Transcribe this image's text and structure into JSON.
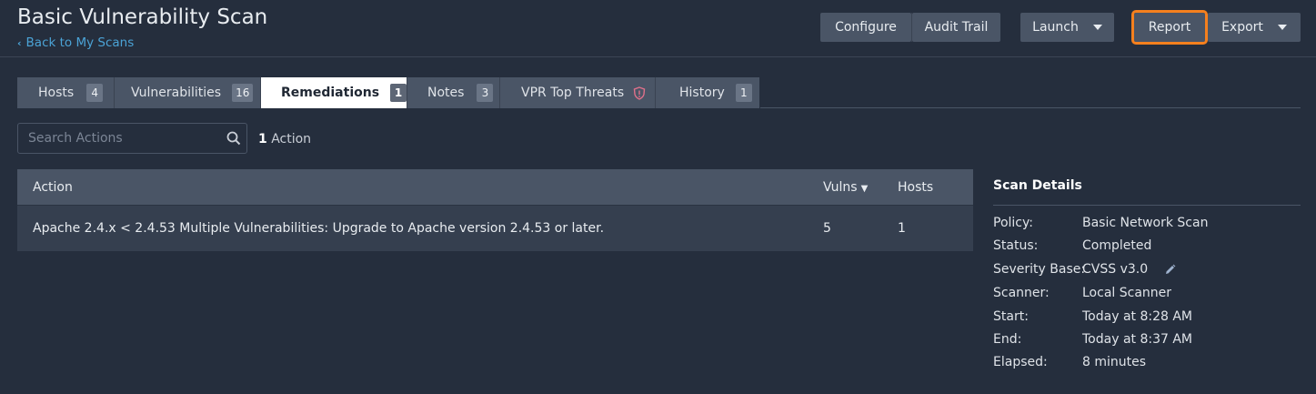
{
  "header": {
    "title": "Basic Vulnerability Scan",
    "back_link": "Back to My Scans"
  },
  "toolbar": {
    "configure": "Configure",
    "audit_trail": "Audit Trail",
    "launch": "Launch",
    "report": "Report",
    "export": "Export"
  },
  "tabs": [
    {
      "label": "Hosts",
      "badge": "4"
    },
    {
      "label": "Vulnerabilities",
      "badge": "16"
    },
    {
      "label": "Remediations",
      "badge": "1",
      "active": true
    },
    {
      "label": "Notes",
      "badge": "3"
    },
    {
      "label": "VPR Top Threats",
      "icon": "shield-icon"
    },
    {
      "label": "History",
      "badge": "1"
    }
  ],
  "search": {
    "placeholder": "Search Actions",
    "count_number": "1",
    "count_label": "Action"
  },
  "table": {
    "headers": {
      "action": "Action",
      "vulns": "Vulns",
      "hosts": "Hosts"
    },
    "rows": [
      {
        "action": "Apache 2.4.x < 2.4.53 Multiple Vulnerabilities: Upgrade to Apache version 2.4.53 or later.",
        "vulns": "5",
        "hosts": "1"
      }
    ]
  },
  "scan_details": {
    "title": "Scan Details",
    "items": [
      {
        "label": "Policy:",
        "value": "Basic Network Scan"
      },
      {
        "label": "Status:",
        "value": "Completed"
      },
      {
        "label": "Severity Base:",
        "value": "CVSS v3.0"
      },
      {
        "label": "Scanner:",
        "value": "Local Scanner"
      },
      {
        "label": "Start:",
        "value": "Today at 8:28 AM"
      },
      {
        "label": "End:",
        "value": "Today at 8:37 AM"
      },
      {
        "label": "Elapsed:",
        "value": "8 minutes"
      }
    ]
  },
  "colors": {
    "background": "#252e3d",
    "button": "#4a5566",
    "highlight": "#f5801e",
    "link": "#4ba3d6",
    "threat_icon": "#e0708a"
  }
}
